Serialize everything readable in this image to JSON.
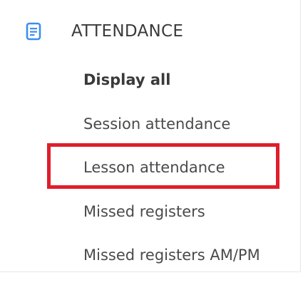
{
  "section": {
    "title": "ATTENDANCE",
    "icon": "document-icon",
    "accent_color": "#3d8ef0"
  },
  "menu": {
    "items": [
      {
        "label": "Display all",
        "bold": true
      },
      {
        "label": "Session attendance",
        "bold": false
      },
      {
        "label": "Lesson attendance",
        "bold": false,
        "highlighted": true
      },
      {
        "label": "Missed registers",
        "bold": false
      },
      {
        "label": "Missed registers AM/PM",
        "bold": false
      }
    ]
  },
  "highlight_color": "#e01e2b"
}
